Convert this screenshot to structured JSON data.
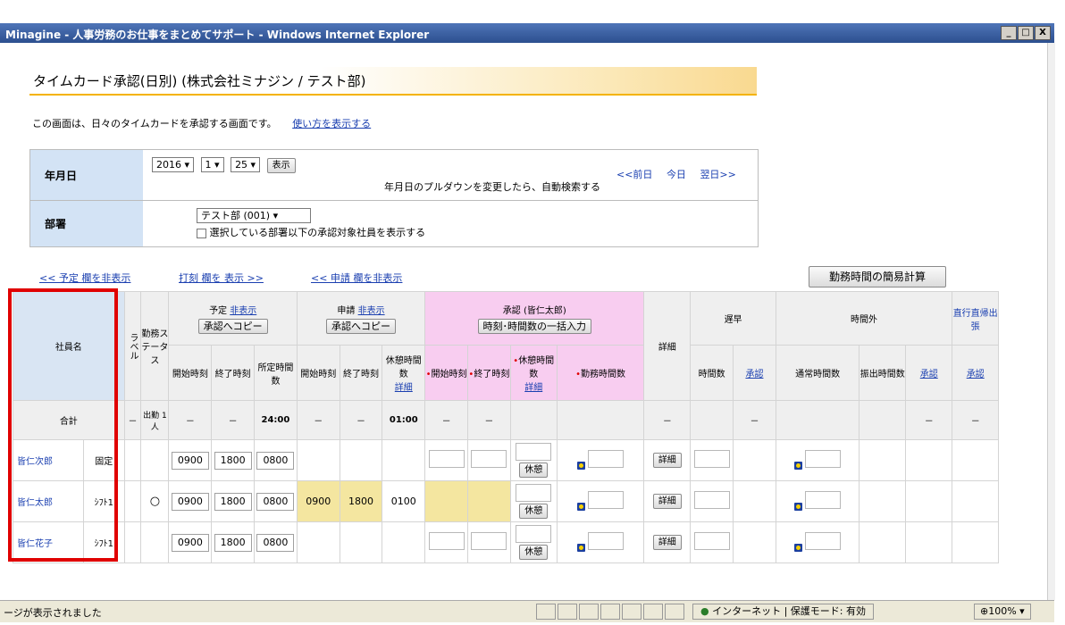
{
  "window": {
    "title": "Minagine - 人事労務のお仕事をまとめてサポート - Windows Internet Explorer",
    "min": "_",
    "max": "□",
    "close": "X"
  },
  "page": {
    "heading": "タイムカード承認(日別) (株式会社ミナジン / テスト部)",
    "intro": "この画面は、日々のタイムカードを承認する画面です。",
    "howto_link": "使い方を表示する"
  },
  "filters": {
    "date_label": "年月日",
    "year": "2016",
    "month": "1",
    "day": "25",
    "show_button": "表示",
    "date_note": "年月日のプルダウンを変更したら、自動検索する",
    "nav_prev": "<<前日",
    "nav_today": "今日",
    "nav_next": "翌日>>",
    "dept_label": "部署",
    "dept_value": "テスト部 (001)",
    "dept_checkbox": "選択している部署以下の承認対象社員を表示する"
  },
  "toggles": {
    "plan": "<< 予定 欄を非表示",
    "punch": "打刻 欄を 表示 >>",
    "apply": "<< 申請 欄を非表示"
  },
  "calc_button": "勤務時間の簡易計算",
  "table": {
    "h_name": "社員名",
    "h_label": "ラベル",
    "h_status": "勤務ステータス",
    "h_plan": "予定",
    "h_apply": "申請",
    "h_hide": "非表示",
    "copy_btn": "承認へコピー",
    "h_approve": "承認 (皆仁太郎)",
    "bulk_btn": "時刻･時間数の一括入力",
    "h_detail": "詳細",
    "h_late": "遅早",
    "h_overtime": "時間外",
    "h_direct": "直行直帰出張",
    "c_start": "開始時刻",
    "c_end": "終了時刻",
    "c_fixed": "所定時間数",
    "c_break": "休憩時間数",
    "c_break_link": "詳細",
    "c_work": "勤務時間数",
    "c_hours": "時間数",
    "c_approve": "承認",
    "c_normal": "通常時間数",
    "c_holiday": "振出時間数",
    "total_label": "合計",
    "total_status": "出勤 1人",
    "total_fixed": "24:00",
    "total_break": "01:00",
    "dash": "－",
    "break_btn": "休憩",
    "detail_btn": "詳細",
    "rows": [
      {
        "name": "皆仁次郎",
        "label": "固定",
        "status": "",
        "ps": "0900",
        "pe": "1800",
        "pf": "0800",
        "as": "",
        "ae": "",
        "ab": ""
      },
      {
        "name": "皆仁太郎",
        "label": "ｼﾌﾄ1",
        "status": "○",
        "ps": "0900",
        "pe": "1800",
        "pf": "0800",
        "as": "0900",
        "ae": "1800",
        "ab": "0100"
      },
      {
        "name": "皆仁花子",
        "label": "ｼﾌﾄ1",
        "status": "",
        "ps": "0900",
        "pe": "1800",
        "pf": "0800",
        "as": "",
        "ae": "",
        "ab": ""
      }
    ]
  },
  "status": {
    "msg": "ージが表示されました",
    "zone": "インターネット | 保護モード: 有効",
    "zoom": "100%"
  }
}
